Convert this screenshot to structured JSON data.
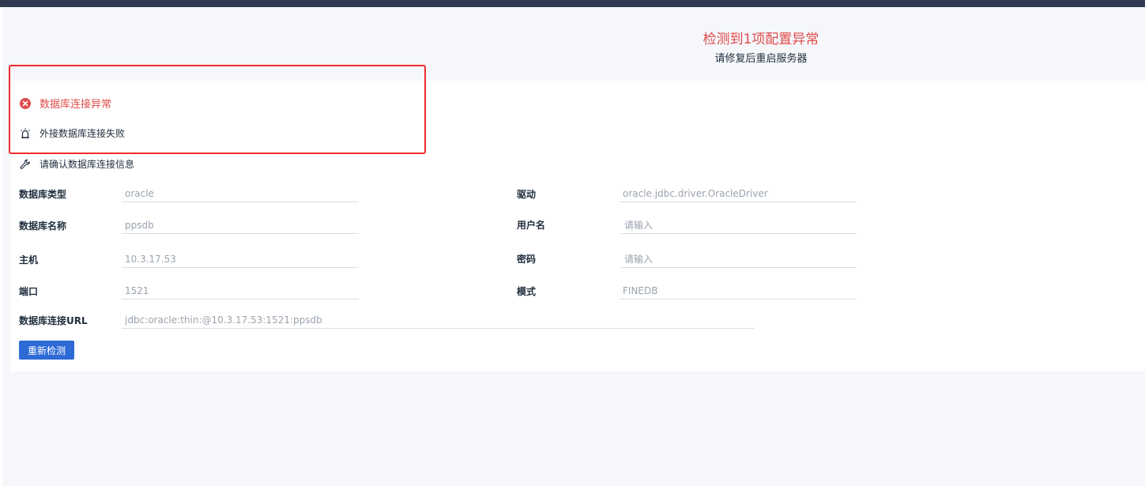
{
  "header": {
    "title": "检测到1项配置异常",
    "subtitle": "请修复后重启服务器"
  },
  "alerts": {
    "error_label": "数据库连接异常",
    "detail_label": "外接数据库连接失败",
    "hint_label": "请确认数据库连接信息"
  },
  "icons": {
    "error": "error-circle-icon",
    "alarm": "alarm-bell-icon",
    "wrench": "wrench-icon"
  },
  "form": {
    "db_type": {
      "label": "数据库类型",
      "value": "oracle"
    },
    "driver": {
      "label": "驱动",
      "value": "oracle.jdbc.driver.OracleDriver"
    },
    "db_name": {
      "label": "数据库名称",
      "value": "ppsdb"
    },
    "username": {
      "label": "用户名",
      "placeholder": "请输入"
    },
    "host": {
      "label": "主机",
      "value": "10.3.17.53"
    },
    "password": {
      "label": "密码",
      "placeholder": "请输入"
    },
    "port": {
      "label": "端口",
      "value": "1521"
    },
    "schema": {
      "label": "模式",
      "value": "FINEDB"
    },
    "url": {
      "label": "数据库连接URL",
      "value": "jdbc:oracle:thin:@10.3.17.53:1521:ppsdb"
    }
  },
  "actions": {
    "recheck_label": "重新检测"
  },
  "colors": {
    "topbar": "#2d3a4f",
    "error": "#e04b4b",
    "highlight_border": "#f02d2d",
    "primary_button": "#2e6ad6"
  }
}
